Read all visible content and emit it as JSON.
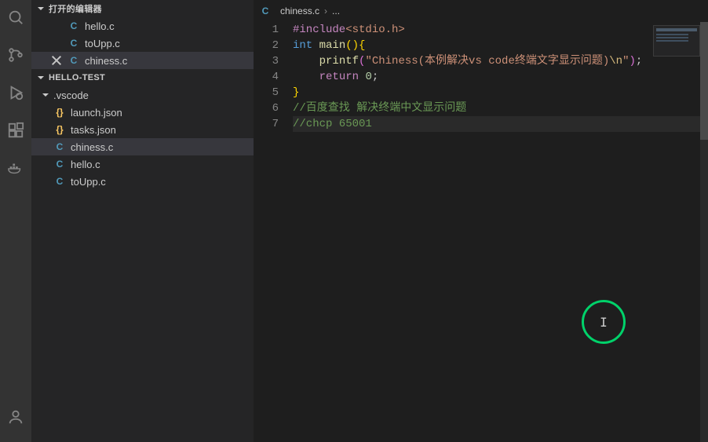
{
  "activity": {
    "tooltips": [
      "search",
      "source-control",
      "run",
      "extensions",
      "docker",
      "account"
    ]
  },
  "sidebar": {
    "openEditorsLabel": "打开的编辑器",
    "openEditors": [
      {
        "icon": "C",
        "name": "hello.c"
      },
      {
        "icon": "C",
        "name": "toUpp.c"
      },
      {
        "icon": "C",
        "name": "chiness.c",
        "active": true
      }
    ],
    "workspaceLabel": "HELLO-TEST",
    "folder": {
      "name": ".vscode"
    },
    "files": [
      {
        "icon": "{}",
        "kind": "json",
        "name": "launch.json"
      },
      {
        "icon": "{}",
        "kind": "json",
        "name": "tasks.json"
      },
      {
        "icon": "C",
        "kind": "c",
        "name": "chiness.c",
        "active": true
      },
      {
        "icon": "C",
        "kind": "c",
        "name": "hello.c"
      },
      {
        "icon": "C",
        "kind": "c",
        "name": "toUpp.c"
      }
    ]
  },
  "breadcrumb": {
    "icon": "C",
    "file": "chiness.c",
    "more": "..."
  },
  "code": {
    "lineNumbers": [
      "1",
      "2",
      "3",
      "4",
      "5",
      "6",
      "7"
    ],
    "l1_inc": "#include",
    "l1_hdr": "<stdio.h>",
    "l2_kw1": "int",
    "l2_fn": "main",
    "l2_rest": "(){",
    "l3_fn": "printf",
    "l3_open": "(",
    "l3_q1": "\"",
    "l3_txt": "Chiness(本例解决vs code终端文字显示问题)",
    "l3_esc": "\\n",
    "l3_q2": "\"",
    "l3_close": ")",
    "l3_semi": ";",
    "l4_kw": "return",
    "l4_num": "0",
    "l4_semi": ";",
    "l5_brace": "}",
    "l6_cmt": "//百度查找 解决终端中文显示问题",
    "l7_cmt": "//chcp 65001"
  }
}
